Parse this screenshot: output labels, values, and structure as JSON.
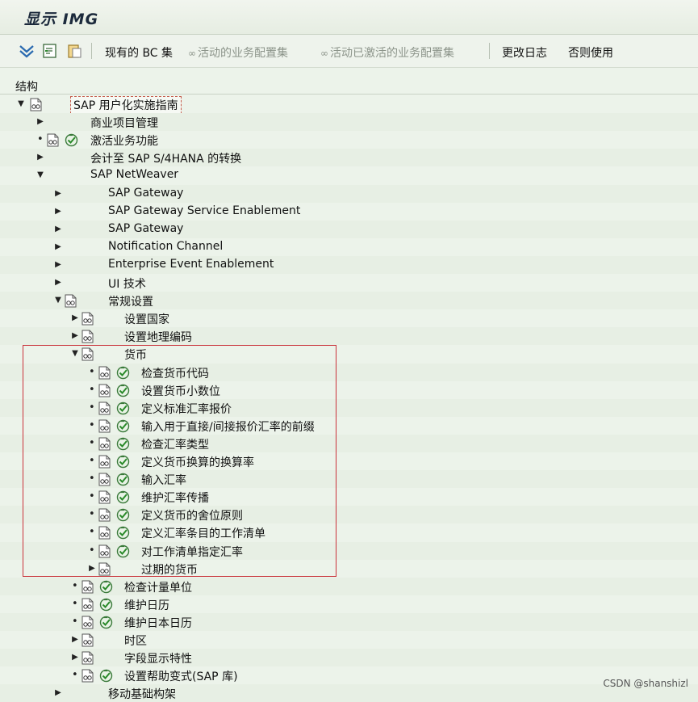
{
  "title": "显示 IMG",
  "toolbar": {
    "existing_bc_sets": "现有的 BC 集",
    "active_bc_sets": "活动的业务配置集",
    "activated_bc_sets": "活动已激活的业务配置集",
    "change_log": "更改日志",
    "otherwise_use": "否则使用"
  },
  "panel": {
    "header": "结构"
  },
  "tree": [
    {
      "label": "SAP 用户化实施指南",
      "level": 0,
      "toggle": "expanded",
      "doc": true,
      "check": false,
      "selected": true
    },
    {
      "label": "商业项目管理",
      "level": 1,
      "toggle": "collapsed",
      "doc": false,
      "check": false
    },
    {
      "label": "激活业务功能",
      "level": 1,
      "toggle": "bullet",
      "doc": true,
      "check": true
    },
    {
      "label": "会计至 SAP S/4HANA 的转换",
      "level": 1,
      "toggle": "collapsed",
      "doc": false,
      "check": false
    },
    {
      "label": "SAP NetWeaver",
      "level": 1,
      "toggle": "expanded",
      "doc": false,
      "check": false
    },
    {
      "label": "SAP Gateway",
      "level": 2,
      "toggle": "collapsed",
      "doc": false,
      "check": false
    },
    {
      "label": "SAP Gateway Service Enablement",
      "level": 2,
      "toggle": "collapsed",
      "doc": false,
      "check": false
    },
    {
      "label": "SAP Gateway",
      "level": 2,
      "toggle": "collapsed",
      "doc": false,
      "check": false
    },
    {
      "label": "Notification Channel",
      "level": 2,
      "toggle": "collapsed",
      "doc": false,
      "check": false
    },
    {
      "label": "Enterprise Event Enablement",
      "level": 2,
      "toggle": "collapsed",
      "doc": false,
      "check": false
    },
    {
      "label": "UI 技术",
      "level": 2,
      "toggle": "collapsed",
      "doc": false,
      "check": false
    },
    {
      "label": "常规设置",
      "level": 2,
      "toggle": "expanded",
      "doc": true,
      "check": false
    },
    {
      "label": "设置国家",
      "level": 3,
      "toggle": "collapsed",
      "doc": true,
      "check": false
    },
    {
      "label": "设置地理编码",
      "level": 3,
      "toggle": "collapsed",
      "doc": true,
      "check": false
    },
    {
      "label": "货币",
      "level": 3,
      "toggle": "expanded",
      "doc": true,
      "check": false
    },
    {
      "label": "检查货币代码",
      "level": 4,
      "toggle": "bullet",
      "doc": true,
      "check": true
    },
    {
      "label": "设置货币小数位",
      "level": 4,
      "toggle": "bullet",
      "doc": true,
      "check": true
    },
    {
      "label": "定义标准汇率报价",
      "level": 4,
      "toggle": "bullet",
      "doc": true,
      "check": true
    },
    {
      "label": "输入用于直接/间接报价汇率的前缀",
      "level": 4,
      "toggle": "bullet",
      "doc": true,
      "check": true
    },
    {
      "label": "检查汇率类型",
      "level": 4,
      "toggle": "bullet",
      "doc": true,
      "check": true
    },
    {
      "label": "定义货币换算的换算率",
      "level": 4,
      "toggle": "bullet",
      "doc": true,
      "check": true
    },
    {
      "label": "输入汇率",
      "level": 4,
      "toggle": "bullet",
      "doc": true,
      "check": true
    },
    {
      "label": "维护汇率传播",
      "level": 4,
      "toggle": "bullet",
      "doc": true,
      "check": true
    },
    {
      "label": "定义货币的舍位原则",
      "level": 4,
      "toggle": "bullet",
      "doc": true,
      "check": true
    },
    {
      "label": "定义汇率条目的工作清单",
      "level": 4,
      "toggle": "bullet",
      "doc": true,
      "check": true
    },
    {
      "label": "对工作清单指定汇率",
      "level": 4,
      "toggle": "bullet",
      "doc": true,
      "check": true
    },
    {
      "label": "过期的货币",
      "level": 4,
      "toggle": "collapsed",
      "doc": true,
      "check": false
    },
    {
      "label": "检查计量单位",
      "level": 3,
      "toggle": "bullet",
      "doc": true,
      "check": true
    },
    {
      "label": "维护日历",
      "level": 3,
      "toggle": "bullet",
      "doc": true,
      "check": true
    },
    {
      "label": "维护日本日历",
      "level": 3,
      "toggle": "bullet",
      "doc": true,
      "check": true
    },
    {
      "label": "时区",
      "level": 3,
      "toggle": "collapsed",
      "doc": true,
      "check": false
    },
    {
      "label": "字段显示特性",
      "level": 3,
      "toggle": "collapsed",
      "doc": true,
      "check": false
    },
    {
      "label": "设置帮助变式(SAP 库)",
      "level": 3,
      "toggle": "bullet",
      "doc": true,
      "check": true
    },
    {
      "label": "移动基础构架",
      "level": 2,
      "toggle": "collapsed",
      "doc": false,
      "check": false
    }
  ],
  "watermark": "CSDN @shanshizl"
}
